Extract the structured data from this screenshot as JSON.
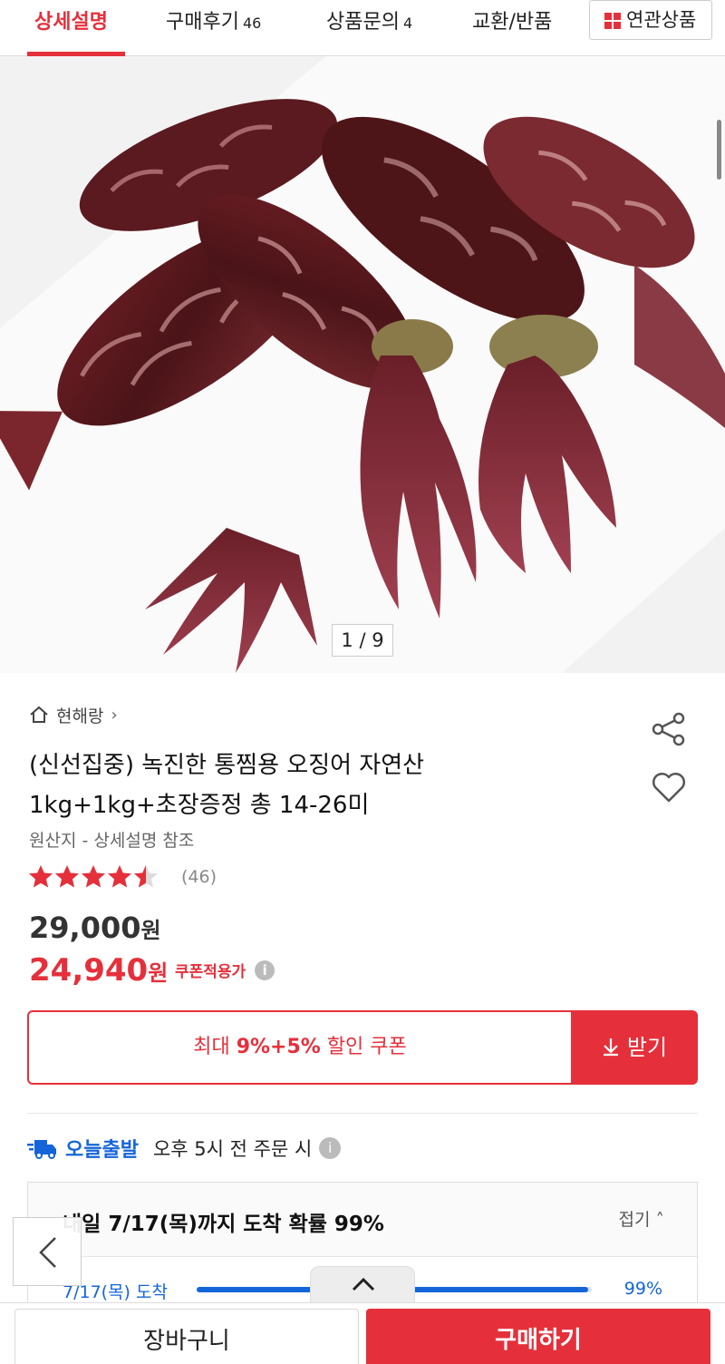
{
  "tabs": [
    {
      "label": "상세설명",
      "count": ""
    },
    {
      "label": "구매후기",
      "count": "46"
    },
    {
      "label": "상품문의",
      "count": "4"
    },
    {
      "label": "교환/반품",
      "count": ""
    }
  ],
  "related_label": "연관상품",
  "image_indicator": "1 / 9",
  "store_name": "현해랑",
  "product": {
    "title_line1": "(신선집중) 녹진한 통찜용 오징어 자연산",
    "title_line2": "1kg+1kg+초장증정 총 14-26미",
    "origin": "원산지 - 상세설명 참조",
    "rating": 4.5,
    "review_count": "(46)",
    "original_price": "29,000",
    "sale_price": "24,940",
    "currency": "원",
    "coupon_note": "쿠폰적용가"
  },
  "coupon": {
    "prefix": "최대 ",
    "amount": "9%+5%",
    "suffix": " 할인 쿠폰",
    "get_label": "받기"
  },
  "shipping": {
    "label": "오늘출발",
    "desc": "오후 5시 전 주문 시",
    "arrival_title": "내일 7/17(목)까지 도착 확률 99%",
    "fold_label": "접기",
    "row_date": "7/17(목) 도착",
    "row_pct": "99%",
    "row_value": 0.99
  },
  "bottom": {
    "cart_label": "장바구니",
    "buy_label": "구매하기"
  },
  "colors": {
    "accent": "#e5303b",
    "shipping_blue": "#1565d8"
  }
}
